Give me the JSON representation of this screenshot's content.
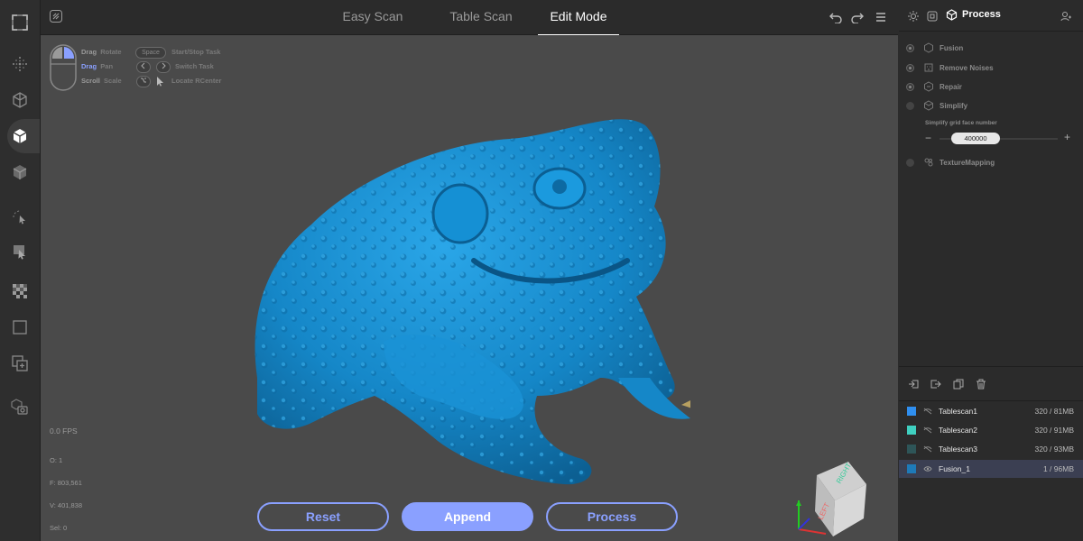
{
  "tabs": [
    {
      "label": "Easy Scan",
      "active": false
    },
    {
      "label": "Table Scan",
      "active": false
    },
    {
      "label": "Edit Mode",
      "active": true
    }
  ],
  "sidebar_tools": [
    "fullscreen-icon",
    "points-icon",
    "wireframe-cube-icon",
    "solid-cube-icon",
    "shaded-cube-icon",
    "select-cursor-icon",
    "select-area-icon",
    "checker-icon",
    "box-select-icon",
    "copy-plus-icon",
    "camera-box-icon"
  ],
  "hints": {
    "drag_rotate": {
      "key": "Drag",
      "action": "Rotate"
    },
    "drag_pan": {
      "key": "Drag",
      "action": "Pan"
    },
    "scroll_scale": {
      "key": "Scroll",
      "action": "Scale"
    },
    "space_key": "Space",
    "space_action": "Start/Stop Task",
    "switch_action": "Switch Task",
    "locate_action": "Locate RCenter"
  },
  "stats": {
    "fps": "0.0 FPS",
    "o": "O: 1",
    "f": "F: 803,561",
    "v": "V: 401,838",
    "sel": "Sel: 0"
  },
  "buttons": {
    "reset": "Reset",
    "append": "Append",
    "process": "Process"
  },
  "orientation_cube": {
    "right": "RIGHT",
    "left": "LEFT"
  },
  "panel": {
    "title": "Process",
    "steps": [
      {
        "label": "Fusion",
        "state": "done"
      },
      {
        "label": "Remove Noises",
        "state": "done"
      },
      {
        "label": "Repair",
        "state": "done"
      },
      {
        "label": "Simplify",
        "state": "pending"
      }
    ],
    "simplify_label": "Simplify grid face number",
    "simplify_value": "400000",
    "texture_label": "TextureMapping",
    "minus": "−",
    "plus": "+"
  },
  "layers": [
    {
      "name": "Tablescan1",
      "size": "320 / 81MB",
      "color": "#2f8ff0",
      "visible": false,
      "selected": false
    },
    {
      "name": "Tablescan2",
      "size": "320 / 91MB",
      "color": "#3fd0c0",
      "visible": false,
      "selected": false
    },
    {
      "name": "Tablescan3",
      "size": "320 / 93MB",
      "color": "#2e5558",
      "visible": false,
      "selected": false
    },
    {
      "name": "Fusion_1",
      "size": "1 / 96MB",
      "color": "#1e7ab8",
      "visible": true,
      "selected": true
    }
  ],
  "colors": {
    "accent": "#8aa0ff",
    "model": "#1a8fd0"
  }
}
